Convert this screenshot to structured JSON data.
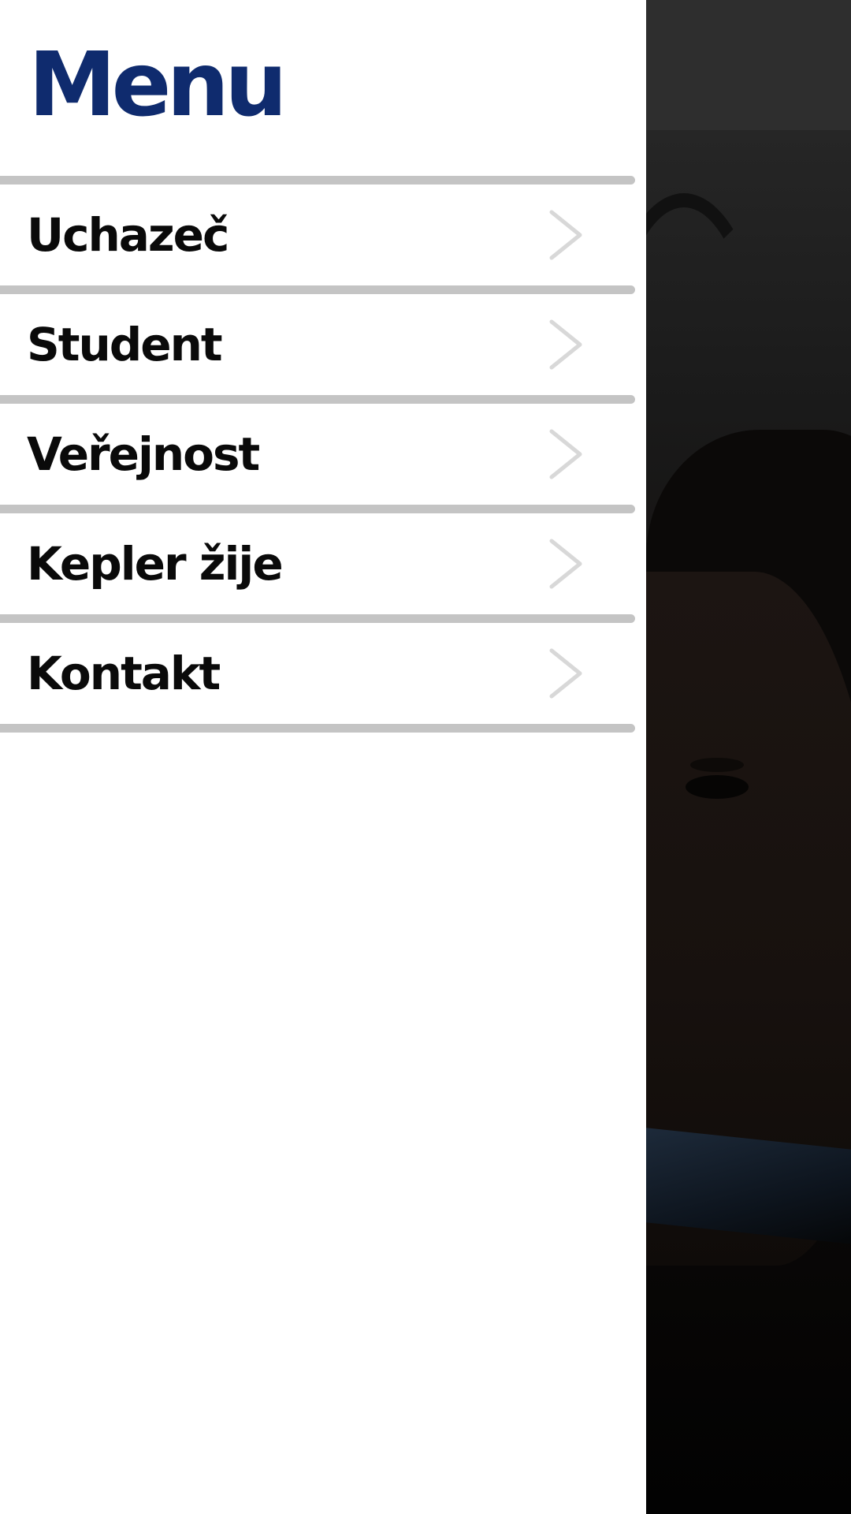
{
  "menu": {
    "title": "Menu",
    "items": [
      {
        "label": "Uchazeč",
        "icon": "chevron-right-icon"
      },
      {
        "label": "Student",
        "icon": "chevron-right-icon"
      },
      {
        "label": "Veřejnost",
        "icon": "chevron-right-icon"
      },
      {
        "label": "Kepler žije",
        "icon": "chevron-right-icon"
      },
      {
        "label": "Kontakt",
        "icon": "chevron-right-icon"
      }
    ]
  },
  "header": {
    "menu_button_icon": "hamburger-menu-icon"
  },
  "colors": {
    "title": "#0f2b6e",
    "item_text": "#0a0a0a",
    "divider": "#c4c4c4",
    "chevron": "#d8d8d8",
    "overlay_header": "#2e2e2e",
    "menu_background": "#ffffff"
  }
}
